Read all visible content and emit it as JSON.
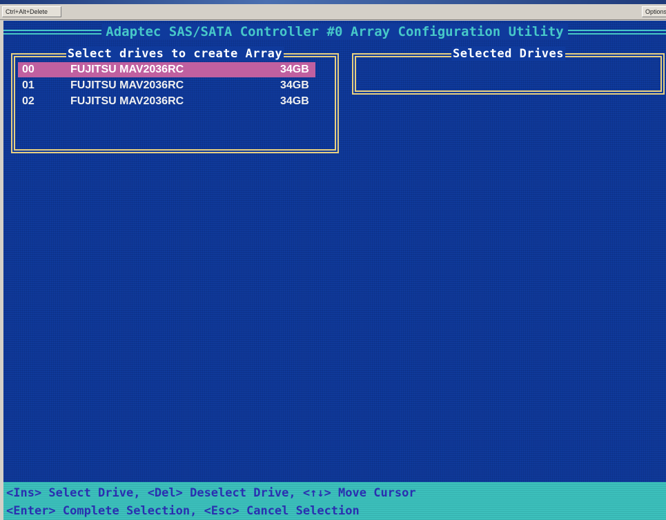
{
  "toolbar": {
    "ctrl_alt_delete_label": "Ctrl+Alt+Delete",
    "options_label": "Options"
  },
  "title": "Adaptec SAS/SATA Controller #0 Array Configuration Utility",
  "left_panel": {
    "title": "Select drives to create Array",
    "drives": [
      {
        "id": "00",
        "name": "FUJITSU MAV2036RC",
        "size": "34GB",
        "selected": true
      },
      {
        "id": "01",
        "name": "FUJITSU MAV2036RC",
        "size": "34GB",
        "selected": false
      },
      {
        "id": "02",
        "name": "FUJITSU MAV2036RC",
        "size": "34GB",
        "selected": false
      }
    ]
  },
  "right_panel": {
    "title": "Selected Drives"
  },
  "footer": {
    "line1": "<Ins> Select Drive, <Del> Deselect Drive, <↑↓> Move Cursor",
    "line2": "<Enter> Complete Selection, <Esc> Cancel Selection"
  },
  "colors": {
    "background": "#0f3a9c",
    "title": "#47c8c8",
    "frame": "#e8d080",
    "highlight": "#c060a0",
    "footer_bg": "#3cc0bc",
    "footer_text": "#2a2fb0"
  }
}
